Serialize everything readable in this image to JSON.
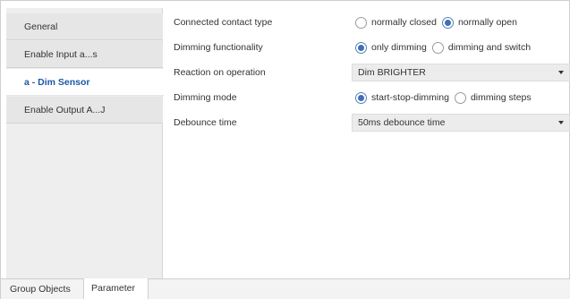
{
  "sidebar": {
    "items": [
      {
        "label": "General",
        "active": false
      },
      {
        "label": "Enable Input a...s",
        "active": false
      },
      {
        "label": "a - Dim Sensor",
        "active": true
      },
      {
        "label": "Enable Output A...J",
        "active": false
      }
    ]
  },
  "parameters": {
    "connected_contact_type": {
      "label": "Connected contact type",
      "options": [
        {
          "label": "normally closed",
          "checked": false
        },
        {
          "label": "normally open",
          "checked": true
        }
      ]
    },
    "dimming_functionality": {
      "label": "Dimming functionality",
      "options": [
        {
          "label": "only dimming",
          "checked": true
        },
        {
          "label": "dimming and switch",
          "checked": false
        }
      ]
    },
    "reaction_on_operation": {
      "label": "Reaction on operation",
      "value": "Dim BRIGHTER"
    },
    "dimming_mode": {
      "label": "Dimming mode",
      "options": [
        {
          "label": "start-stop-dimming",
          "checked": true
        },
        {
          "label": "dimming steps",
          "checked": false
        }
      ]
    },
    "debounce_time": {
      "label": "Debounce time",
      "value": "50ms debounce time"
    }
  },
  "bottom_tabs": [
    {
      "label": "Group Objects",
      "active": false
    },
    {
      "label": "Parameter",
      "active": true
    }
  ],
  "colors": {
    "active_nav_text": "#1c57a6",
    "radio_selected": "#3f6fb5"
  },
  "icons": {
    "radio_checked": "radio-checked-icon",
    "radio_unchecked": "radio-unchecked-icon",
    "dropdown_arrow": "chevron-down-icon"
  }
}
